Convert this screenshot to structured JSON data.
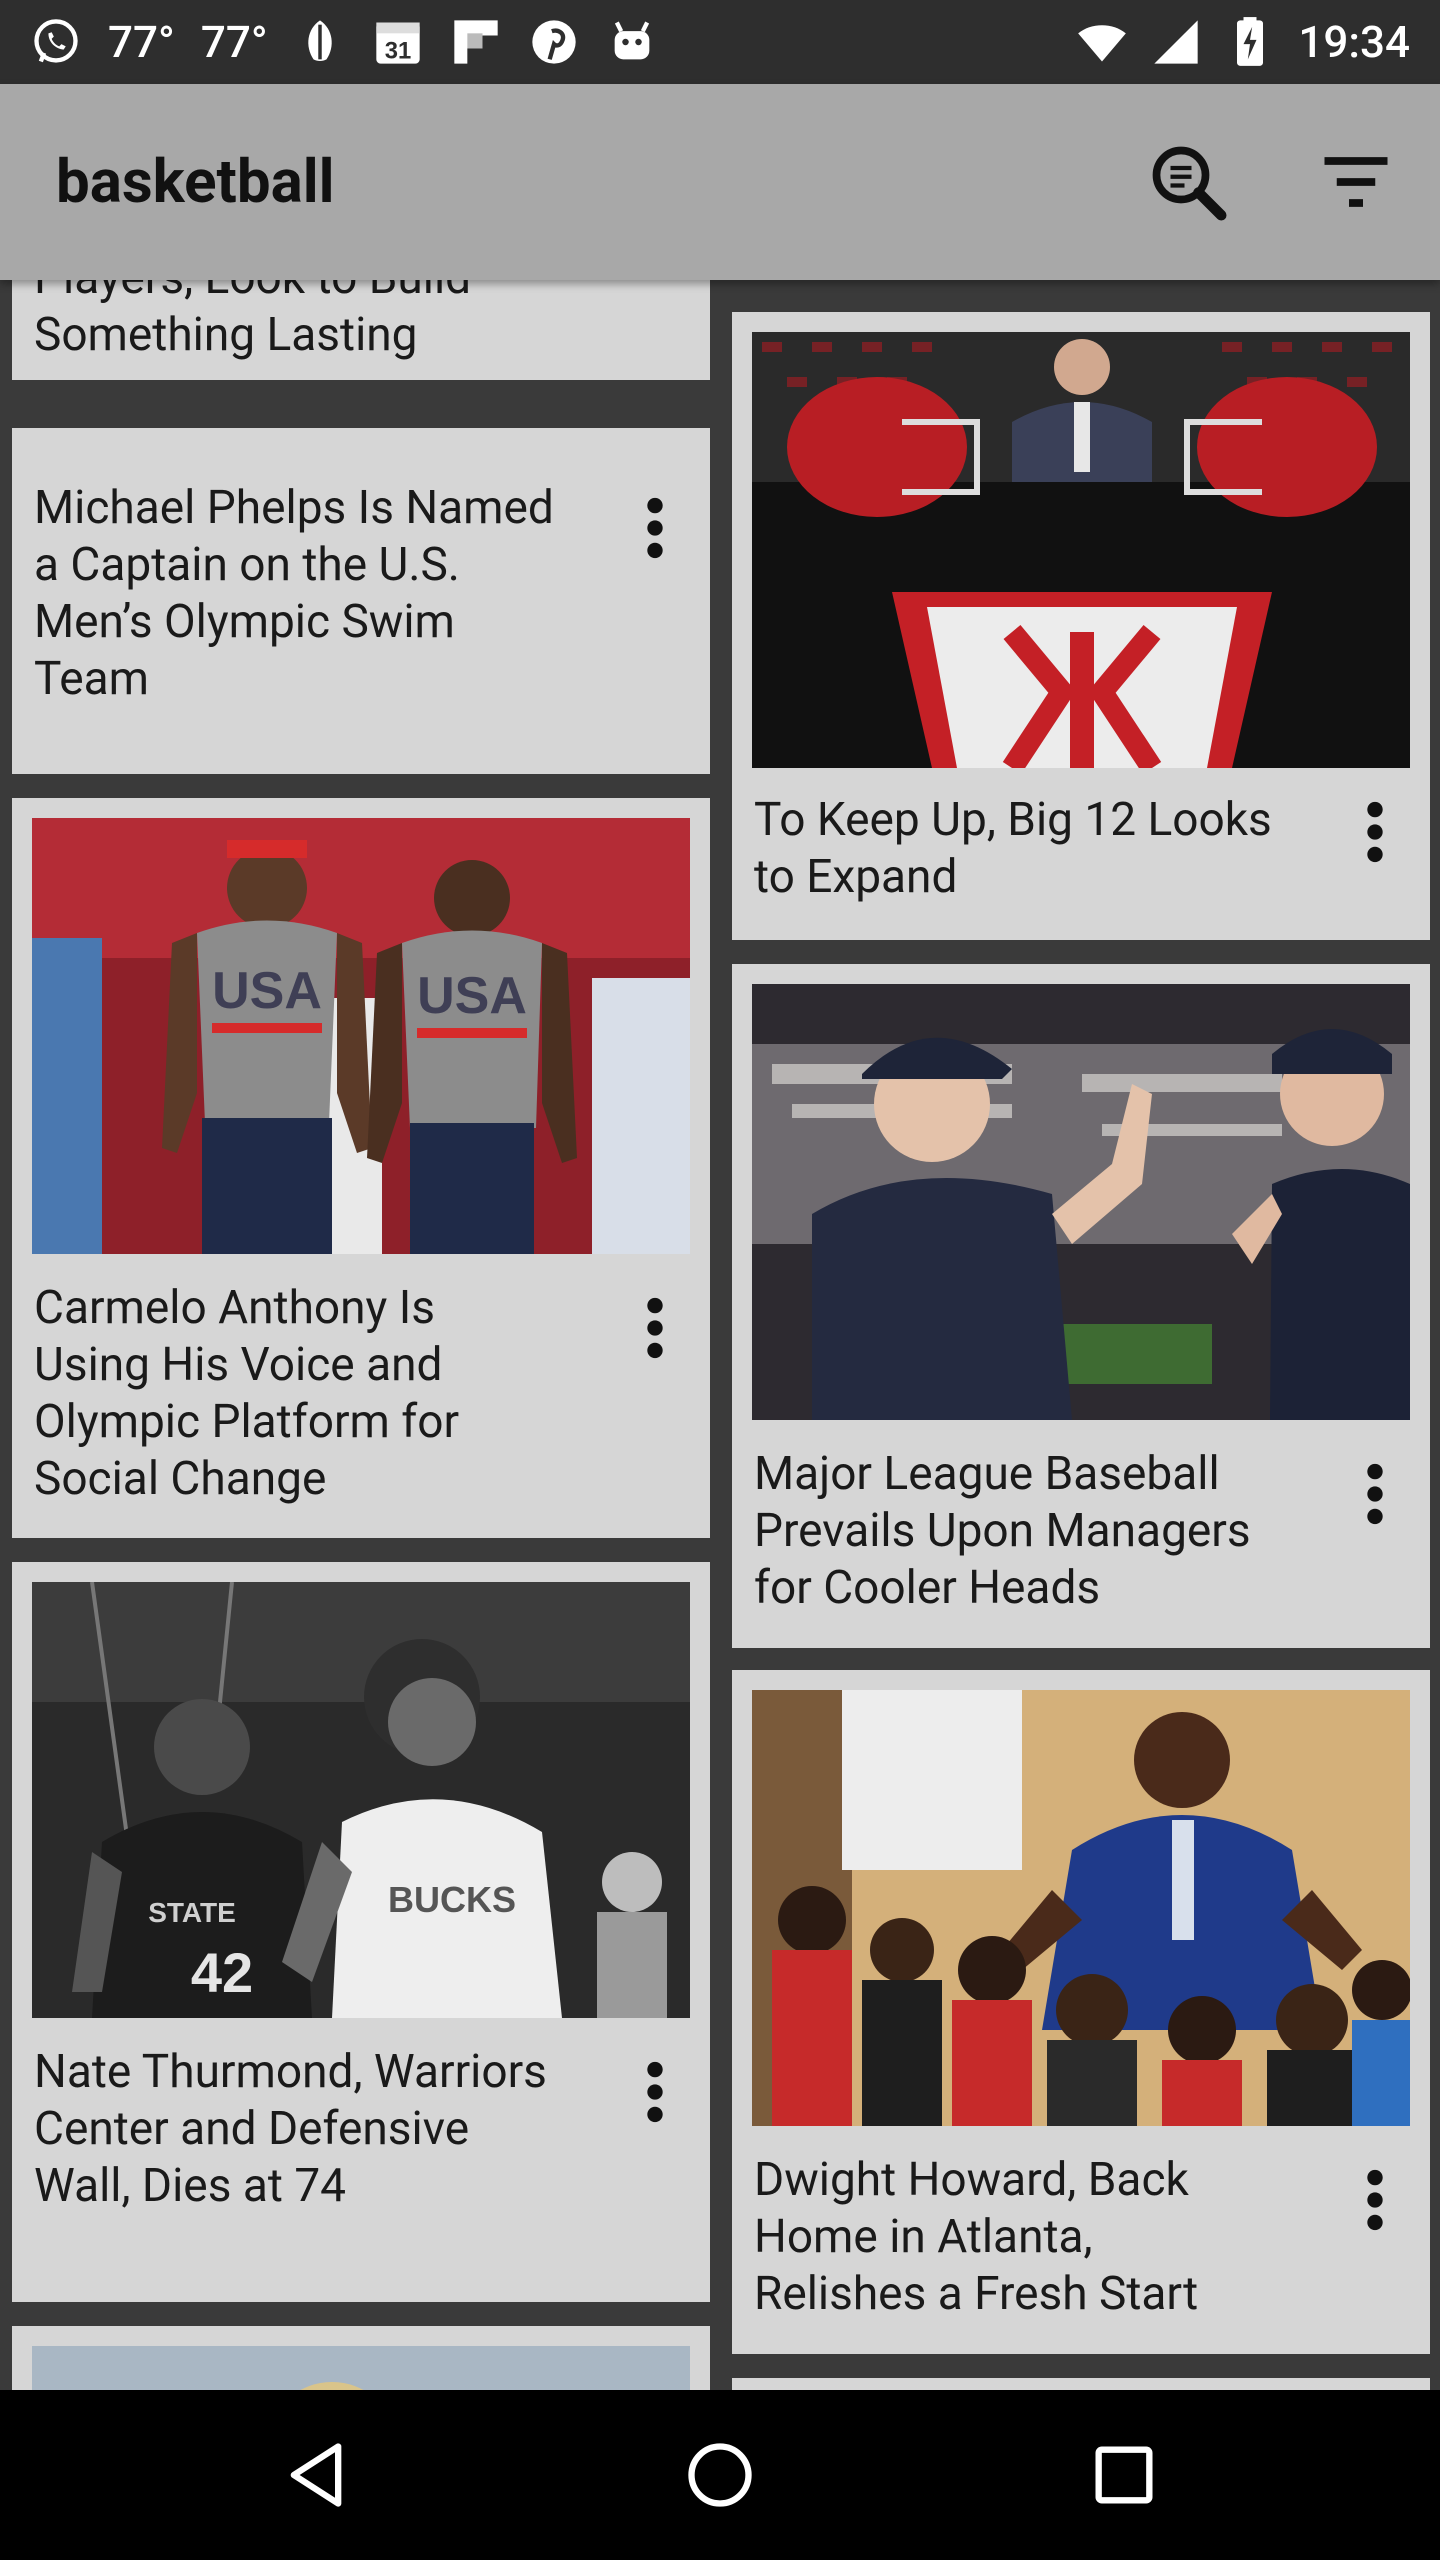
{
  "status_bar": {
    "temp1": "77°",
    "temp2": "77°",
    "calendar_day": "31",
    "time": "19:34"
  },
  "toolbar": {
    "title": "basketball"
  },
  "cards": {
    "left_top": {
      "title": "Players, Look to Build Something Lasting"
    },
    "phelps": {
      "title": "Michael Phelps Is Named a Captain on the U.S. Men’s Olympic Swim Team"
    },
    "carmelo": {
      "title": "Carmelo Anthony Is Using His Voice and Olympic Platform for Social Change"
    },
    "thurmond": {
      "title": "Nate Thurmond, Warriors Center and Defensive Wall, Dies at 74"
    },
    "big12": {
      "title": "To Keep Up, Big 12 Looks to Expand"
    },
    "mlb": {
      "title": "Major League Baseball Prevails Upon Managers for Cooler Heads"
    },
    "howard": {
      "title": "Dwight Howard, Back Home in Atlanta, Relishes a Fresh Start"
    }
  },
  "photo_text": {
    "usa1": "USA",
    "usa2": "USA",
    "jersey_state": "STATE",
    "jersey_number": "42",
    "jersey_bucks": "BUCKS"
  },
  "colors": {
    "status_bar": "#2e2e2e",
    "toolbar": "#a8a8a8",
    "card": "#d6d6d6",
    "background": "#3a3a3a",
    "nav_bar": "#000000"
  }
}
